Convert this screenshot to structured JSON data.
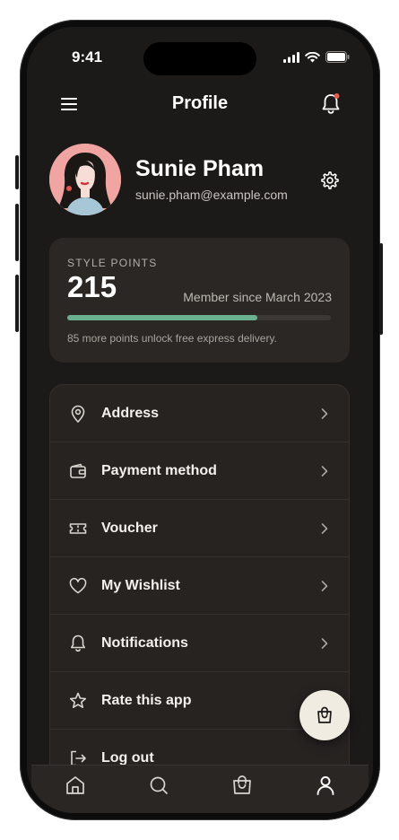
{
  "status_bar": {
    "time": "9:41"
  },
  "header": {
    "title": "Profile",
    "menu_icon": "hamburger-icon",
    "bell_icon": "bell-icon",
    "notification_dot_color": "#e85b4a"
  },
  "profile": {
    "name": "Sunie Pham",
    "email": "sunie.pham@example.com",
    "settings_icon": "gear-icon"
  },
  "points": {
    "label": "STYLE POINTS",
    "value": "215",
    "member_since": "Member since March 2023",
    "progress": 0.72,
    "progress_color": "#6bb08e",
    "note": "85 more points unlock free express delivery."
  },
  "menu": {
    "items": [
      {
        "label": "Address",
        "icon": "location-pin-icon"
      },
      {
        "label": "Payment method",
        "icon": "wallet-icon"
      },
      {
        "label": "Voucher",
        "icon": "ticket-icon"
      },
      {
        "label": "My Wishlist",
        "icon": "heart-icon"
      },
      {
        "label": "Notifications",
        "icon": "bell-icon"
      },
      {
        "label": "Rate this app",
        "icon": "star-icon"
      },
      {
        "label": "Log out",
        "icon": "logout-icon"
      }
    ]
  },
  "fab": {
    "icon": "shopping-bag-icon"
  },
  "tabbar": {
    "tabs": [
      {
        "icon": "home-icon"
      },
      {
        "icon": "search-icon"
      },
      {
        "icon": "shopping-bag-icon"
      },
      {
        "icon": "user-icon",
        "active": true
      }
    ]
  },
  "colors": {
    "background": "#1c1a19",
    "card": "#2a2725",
    "accent": "#6bb08e"
  }
}
